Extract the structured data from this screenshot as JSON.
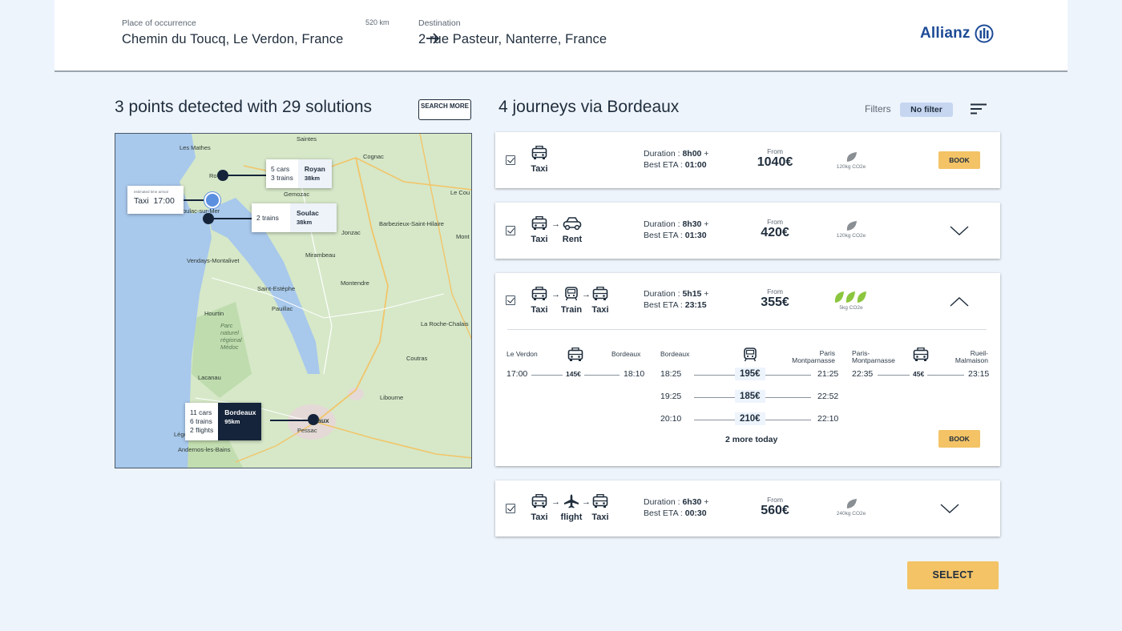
{
  "header": {
    "origin_label": "Place of occurrence",
    "origin_value": "Chemin du Toucq, Le Verdon, France",
    "distance": "520 km",
    "destination_label": "Destination",
    "destination_value": "2 rue Pasteur, Nanterre, France",
    "brand": "Allianz"
  },
  "left": {
    "title": "3 points detected with 29 solutions",
    "search_more": "SEARCH MORE",
    "map": {
      "place_labels": [
        "Les Mathes",
        "Saintes",
        "Cognac",
        "Ro",
        "Gemozac",
        "Le Cou",
        "Barbezieux-Saint-Hilaire",
        "Jonzac",
        "Mont",
        "oulac-sur-Mer",
        "Vendays-Montalivet",
        "Mirambeau",
        "Saint-Estèphe",
        "Montendre",
        "Pauillac",
        "Hourtin",
        "Parc naturel régional Médoc",
        "La Roche-Chalais",
        "Coutras",
        "Lacanau",
        "Libourne",
        "Léger",
        "Pessac",
        "Andernos-les-Bains"
      ],
      "popup_start": {
        "note": "estimated time arrival",
        "mode": "Taxi",
        "time": "17:00"
      },
      "popup_royan": {
        "counts": [
          "5 cars",
          "3 trains"
        ],
        "city": "Royan",
        "dist": "38km"
      },
      "popup_soulac": {
        "counts": [
          "2 trains"
        ],
        "city": "Soulac",
        "dist": "38km"
      },
      "popup_bordeaux": {
        "counts": [
          "11 cars",
          "6 trains",
          "2 flights"
        ],
        "city": "Bordeaux",
        "dist": "95km"
      },
      "bordeaux_map_label": "aux"
    }
  },
  "right": {
    "title": "4 journeys via Bordeaux",
    "filters_label": "Filters",
    "filter_value": "No filter",
    "duration_label": "Duration :",
    "eta_label": "Best ETA :",
    "from_label": "From",
    "journeys": [
      {
        "modes": [
          "Taxi"
        ],
        "duration": "8h00",
        "eta": "01:00",
        "price": "1040€",
        "co2": "120kg CO2e",
        "action": "BOOK"
      },
      {
        "modes": [
          "Taxi",
          "Rent"
        ],
        "duration": "8h30",
        "eta": "01:30",
        "price": "420€",
        "co2": "120kg CO2e"
      },
      {
        "modes": [
          "Taxi",
          "Train",
          "Taxi"
        ],
        "duration": "5h15",
        "eta": "23:15",
        "price": "355€",
        "co2": "5kg CO2e"
      },
      {
        "modes": [
          "Taxi",
          "flight",
          "Taxi"
        ],
        "duration": "6h30",
        "eta": "00:30",
        "price": "560€",
        "co2": "240kg CO2e"
      }
    ],
    "detail": {
      "leg1": {
        "from": "Le Verdon",
        "to": "Bordeaux",
        "dep": "17:00",
        "arr": "18:10",
        "price": "145€"
      },
      "leg2": {
        "from": "Bordeaux",
        "to": "Paris Montparnasse",
        "rows": [
          {
            "dep": "18:25",
            "arr": "21:25",
            "price": "195€"
          },
          {
            "dep": "19:25",
            "arr": "22:52",
            "price": "185€"
          },
          {
            "dep": "20:10",
            "arr": "22:10",
            "price": "210€"
          }
        ]
      },
      "leg3": {
        "from": "Paris-Montparnasse",
        "to": "Rueil-Malmaison",
        "dep": "22:35",
        "arr": "23:15",
        "price": "45€"
      },
      "more": "2 more today",
      "book": "BOOK"
    }
  },
  "select_label": "SELECT",
  "colors": {
    "accent": "#f3c366",
    "navy": "#15243a",
    "brand": "#1d4b96",
    "leaf_green": "#8cc63f",
    "leaf_grey": "#8a8f94"
  }
}
